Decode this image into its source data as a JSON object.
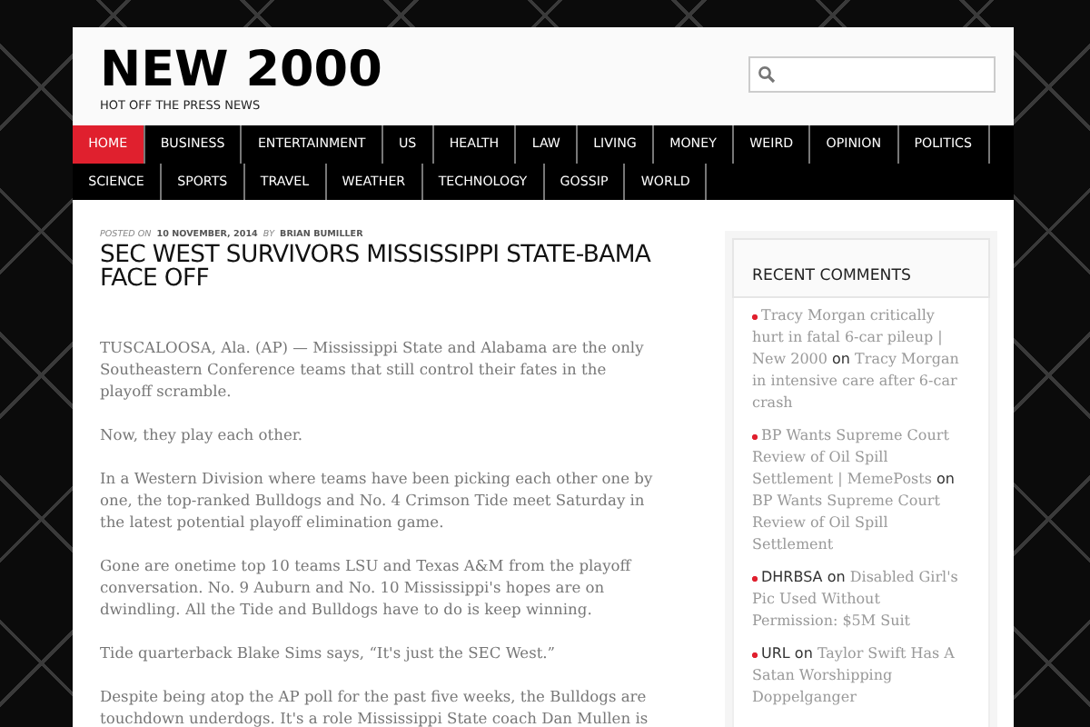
{
  "site": {
    "title": "NEW 2000",
    "tagline": "HOT OFF THE PRESS NEWS"
  },
  "nav": [
    {
      "label": "HOME",
      "selected": true
    },
    {
      "label": "BUSINESS",
      "selected": false
    },
    {
      "label": "ENTERTAINMENT",
      "selected": false
    },
    {
      "label": "US",
      "selected": false
    },
    {
      "label": "HEALTH",
      "selected": false
    },
    {
      "label": "LAW",
      "selected": false
    },
    {
      "label": "LIVING",
      "selected": false
    },
    {
      "label": "MONEY",
      "selected": false
    },
    {
      "label": "WEIRD",
      "selected": false
    },
    {
      "label": "OPINION",
      "selected": false
    },
    {
      "label": "POLITICS",
      "selected": false
    },
    {
      "label": "SCIENCE",
      "selected": false
    },
    {
      "label": "SPORTS",
      "selected": false
    },
    {
      "label": "TRAVEL",
      "selected": false
    },
    {
      "label": "WEATHER",
      "selected": false
    },
    {
      "label": "TECHNOLOGY",
      "selected": false
    },
    {
      "label": "GOSSIP",
      "selected": false
    },
    {
      "label": "WORLD",
      "selected": false
    }
  ],
  "post": {
    "posted_on_label": "POSTED ON",
    "date": "10 NOVEMBER, 2014",
    "by_label": "BY",
    "author": "BRIAN BUMILLER",
    "title": "SEC WEST SURVIVORS MISSISSIPPI STATE-BAMA FACE OFF",
    "paragraphs": [
      "TUSCALOOSA, Ala. (AP) — Mississippi State and Alabama are the only Southeastern Conference teams that still control their fates in the playoff scramble.",
      "Now, they play each other.",
      "In a Western Division where teams have been picking each other one by one, the top-ranked Bulldogs and No. 4 Crimson Tide meet Saturday in the latest potential playoff elimination game.",
      "Gone are onetime top 10 teams LSU and Texas A&M from the playoff conversation. No. 9 Auburn and No. 10 Mississippi's hopes are on dwindling. All the Tide and Bulldogs have to do is keep winning.",
      "Tide quarterback Blake Sims says, “It's just the SEC West.”",
      "Despite being atop the AP poll for the past five weeks, the Bulldogs are touchdown underdogs. It's a role Mississippi State coach Dan Mullen is"
    ]
  },
  "sidebar": {
    "title": "RECENT COMMENTS",
    "comments": [
      {
        "author": "Tracy Morgan critically hurt in fatal 6-car pileup | New 2000",
        "author_is_link": true,
        "on": "on",
        "post": "Tracy Morgan in intensive care after 6-car crash"
      },
      {
        "author": "BP Wants Supreme Court Review of Oil Spill Settlement | MemePosts",
        "author_is_link": true,
        "on": "on",
        "post": "BP Wants Supreme Court Review of Oil Spill Settlement"
      },
      {
        "author": "DHRBSA",
        "author_is_link": false,
        "on": "on",
        "post": "Disabled Girl's Pic Used Without Permission: $5M Suit"
      },
      {
        "author": "URL",
        "author_is_link": false,
        "on": "on",
        "post": "Taylor Swift Has A Satan Worshipping Doppelganger"
      }
    ]
  }
}
